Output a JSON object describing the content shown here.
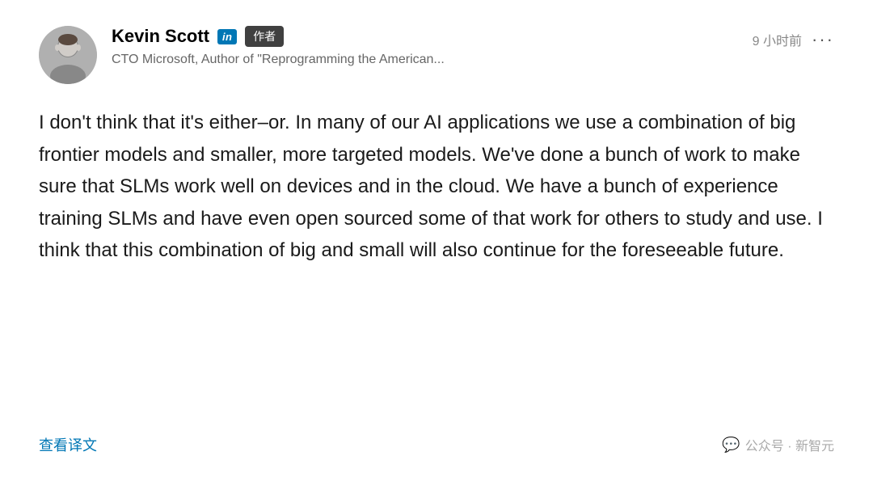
{
  "header": {
    "user_name": "Kevin Scott",
    "linkedin_label": "in",
    "author_label": "作者",
    "user_title": "CTO Microsoft, Author of \"Reprogramming the American...",
    "time_ago": "9 小时前",
    "more_label": "···"
  },
  "post": {
    "body": "I don't think that it's either–or. In many of our AI applications we use a combination of big frontier models and smaller, more targeted models. We've done a bunch of work to make sure that SLMs work well on devices and in the cloud. We have a bunch of experience training SLMs and have even open sourced some of that work for others to study and use. I think that this combination of big and small will also continue for the foreseeable future."
  },
  "footer": {
    "translate_label": "查看译文",
    "wechat_prefix": "公众号 · 新智元"
  },
  "colors": {
    "linkedin_blue": "#0077b5",
    "author_dark": "#404040",
    "text_dark": "#1a1a1a",
    "text_gray": "#666666",
    "text_light": "#aaaaaa"
  }
}
